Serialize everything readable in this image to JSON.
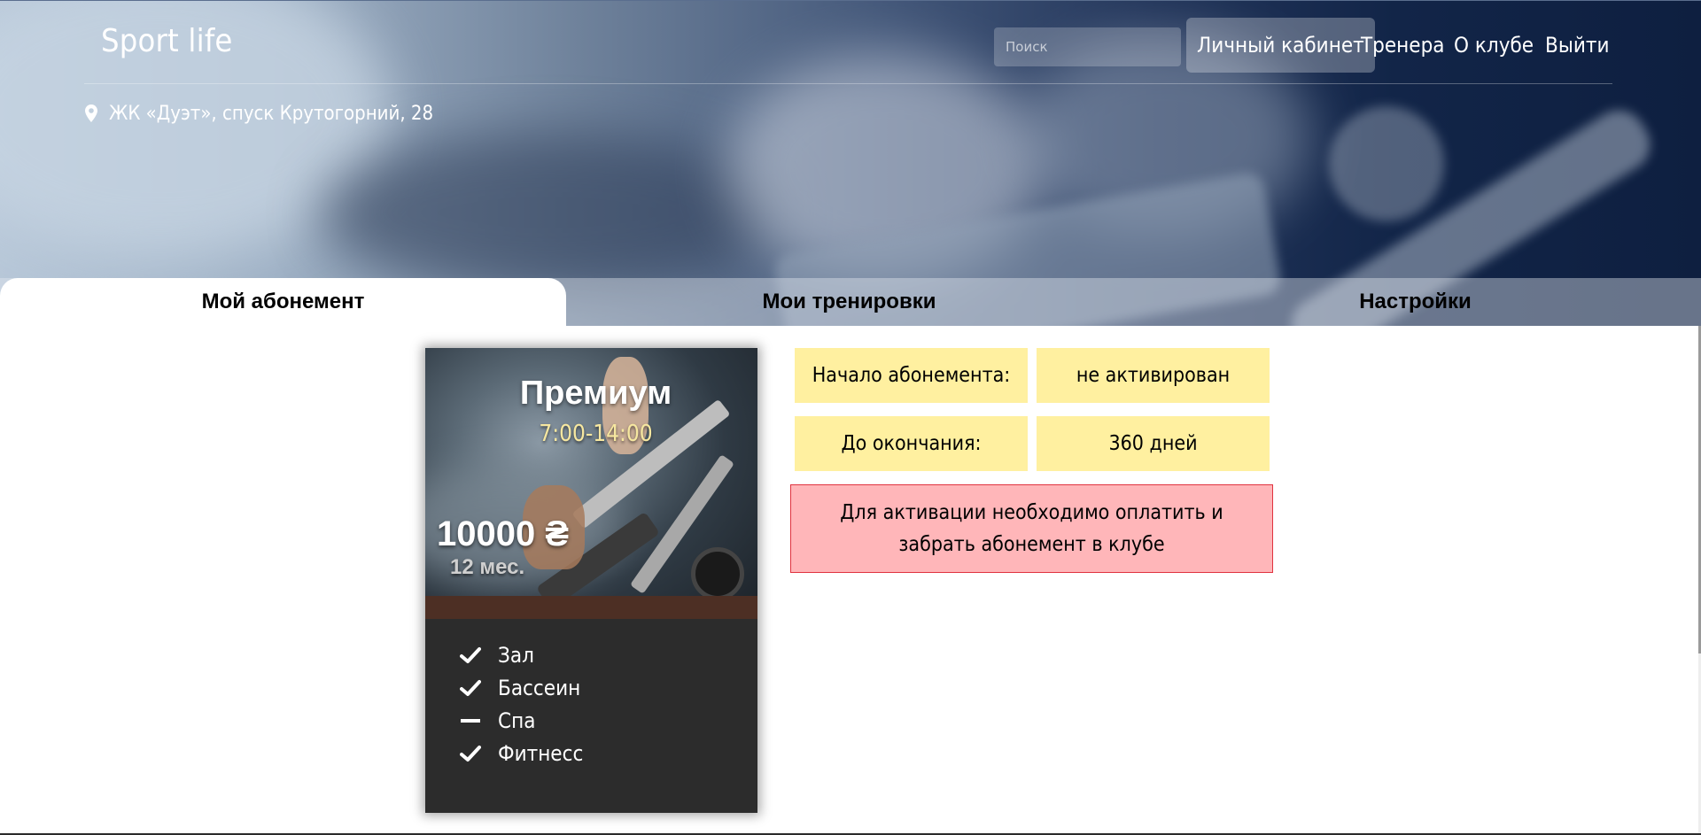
{
  "brand": "Sport life",
  "search": {
    "placeholder": "Поиск"
  },
  "nav": [
    {
      "label": "Личный кабинет",
      "active": true
    },
    {
      "label": "Тренера",
      "active": false
    },
    {
      "label": "О клубе",
      "active": false
    },
    {
      "label": "Выйти",
      "active": false
    }
  ],
  "address": {
    "icon": "map-marker-icon",
    "text": "ЖК «Дуэт», спуск Крутогорний, 28"
  },
  "tabs": [
    {
      "label": "Мой абонемент",
      "active": true
    },
    {
      "label": "Мои тренировки",
      "active": false
    },
    {
      "label": "Настройки",
      "active": false
    }
  ],
  "membership_card": {
    "title": "Премиум",
    "hours": "7:00-14:00",
    "price": "10000 ₴",
    "period": "12 мес.",
    "features": [
      {
        "label": "Зал",
        "included": true,
        "icon": "check-icon"
      },
      {
        "label": "Бассеин",
        "included": true,
        "icon": "check-icon"
      },
      {
        "label": "Спа",
        "included": false,
        "icon": "dash-icon"
      },
      {
        "label": "Фитнесс",
        "included": true,
        "icon": "check-icon"
      }
    ]
  },
  "info": {
    "start_label": "Начало абонемента:",
    "start_value": "не активирован",
    "remaining_label": "До окончания:",
    "remaining_value": "360 дней"
  },
  "alert": {
    "text": "Для активации необходимо оплатить и забрать абонемент в клубе"
  },
  "colors": {
    "info_bg": "#fff0a0",
    "alert_bg": "#ffb6b9",
    "alert_border": "#e0333f",
    "card_bg": "#2c2c2c",
    "hours_color": "#f6e7a0"
  }
}
